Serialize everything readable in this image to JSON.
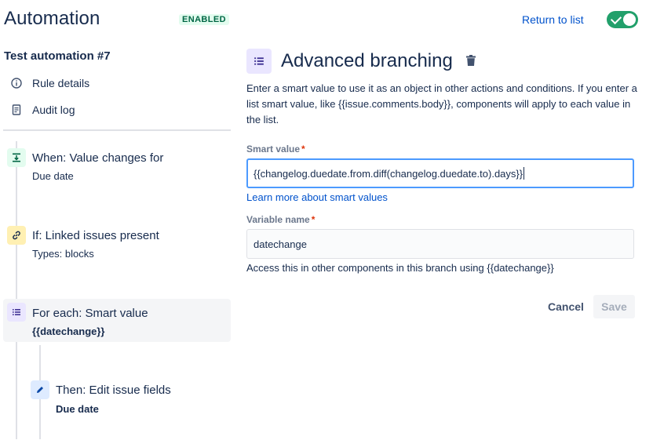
{
  "header": {
    "title": "Automation",
    "status_badge": "ENABLED",
    "return_link": "Return to list",
    "toggle_on": true
  },
  "sidebar": {
    "rule_name": "Test automation #7",
    "links": [
      {
        "label": "Rule details",
        "icon": "info-icon"
      },
      {
        "label": "Audit log",
        "icon": "document-icon"
      }
    ],
    "steps": [
      {
        "title": "When: Value changes for",
        "subtitle": "Due date",
        "icon": "trigger-icon",
        "color": "#e3fcef"
      },
      {
        "title": "If: Linked issues present",
        "subtitle": "Types: blocks",
        "icon": "link-icon",
        "color": "#fff0b3"
      },
      {
        "title": "For each: Smart value",
        "subtitle": "{{datechange}}",
        "icon": "list-icon",
        "color": "#eae6ff",
        "selected": true
      },
      {
        "title": "Then: Edit issue fields",
        "subtitle": "Due date",
        "icon": "pencil-icon",
        "color": "#deebff"
      }
    ]
  },
  "panel": {
    "title": "Advanced branching",
    "icon": "list-icon",
    "description": "Enter a smart value to use it as an object in other actions and conditions. If you enter a list smart value, like {{issue.comments.body}}, components will apply to each value in the list.",
    "smart_value": {
      "label": "Smart value",
      "required_mark": "*",
      "value": "{{changelog.duedate.from.diff(changelog.duedate.to).days}}",
      "learn_more": "Learn more about smart values"
    },
    "variable_name": {
      "label": "Variable name",
      "required_mark": "*",
      "value": "datechange",
      "helper": "Access this in other components in this branch using {{datechange}}"
    },
    "buttons": {
      "cancel": "Cancel",
      "save": "Save"
    }
  },
  "colors": {
    "accent": "#0052cc",
    "toggle": "#22a06b",
    "focus_border": "#4c9aff",
    "required": "#de350b"
  }
}
